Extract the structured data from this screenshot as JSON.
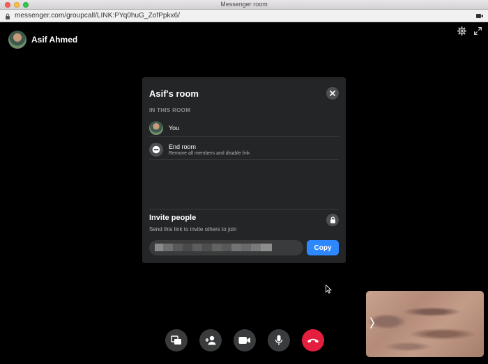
{
  "window": {
    "title": "Messenger room"
  },
  "address_bar": {
    "url": "messenger.com/groupcall/LINK:PYq0huG_ZofPpkx6/"
  },
  "call": {
    "user_name": "Asif Ahmed"
  },
  "modal": {
    "title": "Asif's room",
    "section_heading": "IN THIS ROOM",
    "member_you": "You",
    "end_room_label": "End room",
    "end_room_sub": "Remove all members and disable link",
    "invite_title": "Invite people",
    "invite_sub": "Send this link to invite others to join",
    "copy_label": "Copy"
  },
  "icons": {
    "lock": "lock-icon",
    "camera_indicator": "camera-indicator-icon",
    "settings": "gear-icon",
    "fullscreen": "expand-icon",
    "close": "close-icon",
    "end_room": "minus-circle-icon",
    "invite_lock": "lock-icon",
    "chevron": "chevron-right-icon",
    "controls": [
      "screen-share-icon",
      "add-person-icon",
      "video-camera-icon",
      "microphone-icon",
      "hang-up-icon"
    ]
  },
  "colors": {
    "accent": "#2d88ff",
    "hangup": "#e41e3f",
    "modal_bg": "#242526"
  }
}
